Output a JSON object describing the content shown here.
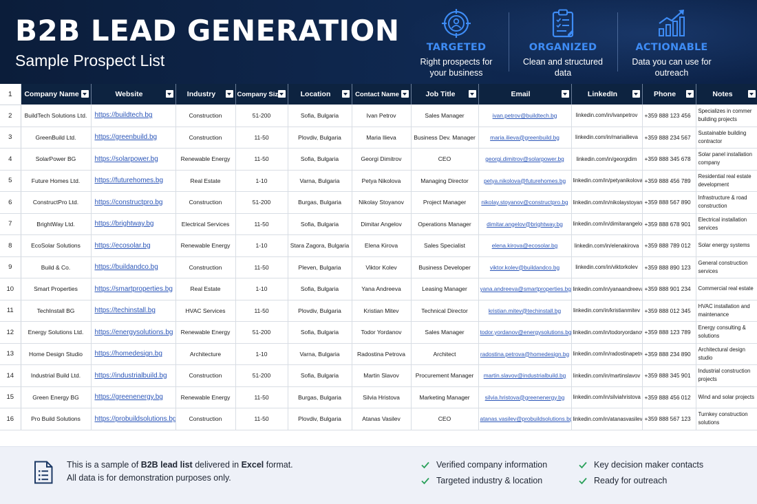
{
  "header": {
    "title": "B2B LEAD GENERATION",
    "subtitle": "Sample Prospect List",
    "features": [
      {
        "icon": "target-person-icon",
        "title": "TARGETED",
        "line1": "Right prospects for",
        "line2": "your business"
      },
      {
        "icon": "clipboard-checklist-icon",
        "title": "ORGANIZED",
        "line1": "Clean and structured",
        "line2": "data"
      },
      {
        "icon": "bar-chart-growth-icon",
        "title": "ACTIONABLE",
        "line1": "Data you can use for",
        "line2": "outreach"
      }
    ],
    "accent_color": "#3e8cf5",
    "background_color": "#0f2850"
  },
  "table": {
    "header_row_number": "1",
    "columns": [
      "Company Name",
      "Website",
      "Industry",
      "Company Size",
      "Location",
      "Contact Name",
      "Job Title",
      "Email",
      "LinkedIn",
      "Phone",
      "Notes"
    ],
    "rows": [
      {
        "num": "2",
        "company": "BuildTech Solutions Ltd.",
        "website": "https://buildtech.bg",
        "industry": "Construction",
        "size": "51-200",
        "location": "Sofia, Bulgaria",
        "contact": "Ivan Petrov",
        "title": "Sales Manager",
        "email": "ivan.petrov@buildtech.bg",
        "linkedin": "linkedin.com/in/ivanpetrov",
        "phone": "+359 888 123 456",
        "notes": "Specializes in commer building projects"
      },
      {
        "num": "3",
        "company": "GreenBuild Ltd.",
        "website": "https://greenbuild.bg",
        "industry": "Construction",
        "size": "11-50",
        "location": "Plovdiv, Bulgaria",
        "contact": "Maria Ilieva",
        "title": "Business Dev. Manager",
        "email": "maria.ilieva@greenbuild.bg",
        "linkedin": "linkedin.com/in/mariailieva",
        "phone": "+359 888 234 567",
        "notes": "Sustainable building contractor"
      },
      {
        "num": "4",
        "company": "SolarPower BG",
        "website": "https://solarpower.bg",
        "industry": "Renewable Energy",
        "size": "11-50",
        "location": "Sofia, Bulgaria",
        "contact": "Georgi Dimitrov",
        "title": "CEO",
        "email": "georgi.dimitrov@solarpower.bg",
        "linkedin": "linkedin.com/in/georgidim",
        "phone": "+359 888 345 678",
        "notes": "Solar panel installation company"
      },
      {
        "num": "5",
        "company": "Future Homes Ltd.",
        "website": "https://futurehomes.bg",
        "industry": "Real Estate",
        "size": "1-10",
        "location": "Varna, Bulgaria",
        "contact": "Petya Nikolova",
        "title": "Managing Director",
        "email": "petya.nikolova@futurehomes.bg",
        "linkedin": "linkedin.com/in/petyanikolova",
        "phone": "+359 888 456 789",
        "notes": "Residential real estate development"
      },
      {
        "num": "6",
        "company": "ConstructPro Ltd.",
        "website": "https://constructpro.bg",
        "industry": "Construction",
        "size": "51-200",
        "location": "Burgas, Bulgaria",
        "contact": "Nikolay Stoyanov",
        "title": "Project Manager",
        "email": "nikolay.stoyanov@constructpro.bg",
        "linkedin": "linkedin.com/in/nikolaystoyanov",
        "phone": "+359 888 567 890",
        "notes": "Infrastructure & road construction"
      },
      {
        "num": "7",
        "company": "BrightWay Ltd.",
        "website": "https://brightway.bg",
        "industry": "Electrical Services",
        "size": "11-50",
        "location": "Sofia, Bulgaria",
        "contact": "Dimitar Angelov",
        "title": "Operations Manager",
        "email": "dimitar.angelov@brightway.bg",
        "linkedin": "linkedin.com/in/dimitarangelov",
        "phone": "+359 888 678 901",
        "notes": "Electrical installation services"
      },
      {
        "num": "8",
        "company": "EcoSolar Solutions",
        "website": "https://ecosolar.bg",
        "industry": "Renewable Energy",
        "size": "1-10",
        "location": "Stara Zagora, Bulgaria",
        "contact": "Elena Kirova",
        "title": "Sales Specialist",
        "email": "elena.kirova@ecosolar.bg",
        "linkedin": "linkedin.com/in/elenakirova",
        "phone": "+359 888 789 012",
        "notes": "Solar energy systems"
      },
      {
        "num": "9",
        "company": "Build & Co.",
        "website": "https://buildandco.bg",
        "industry": "Construction",
        "size": "11-50",
        "location": "Pleven, Bulgaria",
        "contact": "Viktor Kolev",
        "title": "Business Developer",
        "email": "viktor.kolev@buildandco.bg",
        "linkedin": "linkedin.com/in/viktorkolev",
        "phone": "+359 888 890 123",
        "notes": "General construction services"
      },
      {
        "num": "10",
        "company": "Smart Properties",
        "website": "https://smartproperties.bg",
        "industry": "Real Estate",
        "size": "1-10",
        "location": "Sofia, Bulgaria",
        "contact": "Yana Andreeva",
        "title": "Leasing Manager",
        "email": "yana.andreeva@smartproperties.bg",
        "linkedin": "linkedin.com/in/yanaandreeva",
        "phone": "+359 888 901 234",
        "notes": "Commercial real estate"
      },
      {
        "num": "11",
        "company": "TechInstall BG",
        "website": "https://techinstall.bg",
        "industry": "HVAC Services",
        "size": "11-50",
        "location": "Plovdiv, Bulgaria",
        "contact": "Kristian Mitev",
        "title": "Technical Director",
        "email": "kristian.mitev@techinstall.bg",
        "linkedin": "linkedin.com/in/kristianmitev",
        "phone": "+359 888 012 345",
        "notes": "HVAC installation and maintenance"
      },
      {
        "num": "12",
        "company": "Energy Solutions Ltd.",
        "website": "https://energysolutions.bg",
        "industry": "Renewable Energy",
        "size": "51-200",
        "location": "Sofia, Bulgaria",
        "contact": "Todor Yordanov",
        "title": "Sales Manager",
        "email": "todor.yordanov@energysolutions.bg",
        "linkedin": "linkedin.com/in/todoryordanov",
        "phone": "+359 888 123 789",
        "notes": "Energy consulting & solutions"
      },
      {
        "num": "13",
        "company": "Home Design Studio",
        "website": "https://homedesign.bg",
        "industry": "Architecture",
        "size": "1-10",
        "location": "Varna, Bulgaria",
        "contact": "Radostina Petrova",
        "title": "Architect",
        "email": "radostina.petrova@homedesign.bg",
        "linkedin": "linkedin.com/in/radostinapetrova",
        "phone": "+359 888 234 890",
        "notes": "Architectural design studio"
      },
      {
        "num": "14",
        "company": "Industrial Build Ltd.",
        "website": "https://industrialbuild.bg",
        "industry": "Construction",
        "size": "51-200",
        "location": "Sofia, Bulgaria",
        "contact": "Martin Slavov",
        "title": "Procurement Manager",
        "email": "martin.slavov@industrialbuild.bg",
        "linkedin": "linkedin.com/in/martinslavov",
        "phone": "+359 888 345 901",
        "notes": "Industrial construction projects"
      },
      {
        "num": "15",
        "company": "Green Energy BG",
        "website": "https://greenenergy.bg",
        "industry": "Renewable Energy",
        "size": "11-50",
        "location": "Burgas, Bulgaria",
        "contact": "Silvia Hristova",
        "title": "Marketing Manager",
        "email": "silvia.hristova@greenenergy.bg",
        "linkedin": "linkedin.com/in/silviahristova",
        "phone": "+359 888 456 012",
        "notes": "Wind and solar projects"
      },
      {
        "num": "16",
        "company": "Pro Build Solutions",
        "website": "https://probuildsolutions.bg",
        "industry": "Construction",
        "size": "11-50",
        "location": "Plovdiv, Bulgaria",
        "contact": "Atanas Vasilev",
        "title": "CEO",
        "email": "atanas.vasilev@probuildsolutions.bg",
        "linkedin": "linkedin.com/in/atanasvasilev",
        "phone": "+359 888 567 123",
        "notes": "Turnkey construction solutions"
      }
    ],
    "header_color": "#0d2340",
    "link_color": "#2a55b8"
  },
  "footer": {
    "icon": "document-list-icon",
    "line1_a": "This is a sample of ",
    "line1_b": "B2B lead list",
    "line1_c": " delivered in ",
    "line1_d": "Excel",
    "line1_e": " format.",
    "line2": "All data is for demonstration purposes only.",
    "checks": [
      "Verified company information",
      "Targeted industry & location",
      "Key decision maker contacts",
      "Ready for outreach"
    ],
    "check_color": "#2aa05a"
  }
}
